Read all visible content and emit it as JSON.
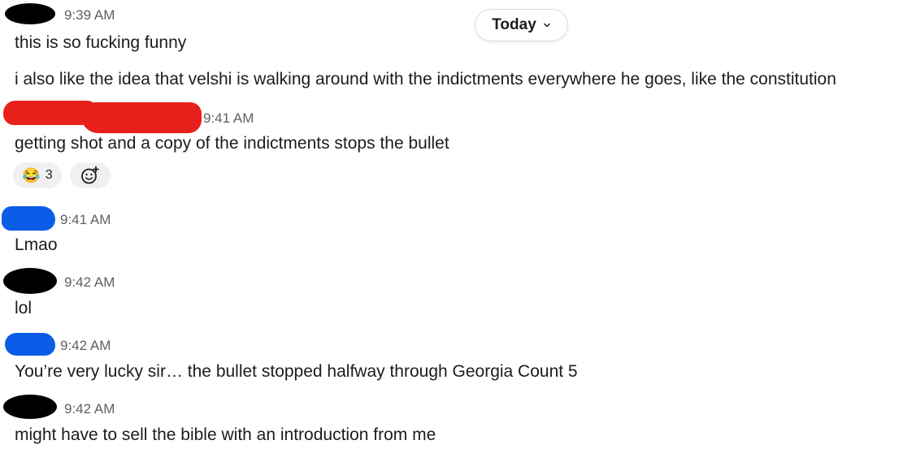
{
  "date_divider": {
    "label": "Today",
    "chevron_icon": "chevron-down-icon"
  },
  "colors": {
    "redaction_black": "#000000",
    "redaction_red": "#e8201c",
    "redaction_blue": "#0b5ce6",
    "timestamp": "#616061",
    "text": "#1d1c1d",
    "reaction_bg": "#f0f0f0"
  },
  "messages": [
    {
      "time": "9:39 AM",
      "lines": [
        "this is so fucking funny",
        "i also like the idea that velshi is walking around with the indictments everywhere he goes, like the constitution"
      ]
    },
    {
      "time": "9:41 AM",
      "lines": [
        "getting shot and a copy of the indictments stops the bullet"
      ],
      "reactions": [
        {
          "emoji": "😂",
          "icon": "joy-emoji-icon",
          "count": "3"
        }
      ],
      "add_reaction_icon": "add-reaction-icon"
    },
    {
      "time": "9:41 AM",
      "lines": [
        "Lmao"
      ]
    },
    {
      "time": "9:42 AM",
      "lines": [
        "lol"
      ]
    },
    {
      "time": "9:42 AM",
      "lines": [
        "You’re very lucky sir… the bullet stopped halfway through Georgia Count 5"
      ]
    },
    {
      "time": "9:42 AM",
      "lines": [
        "might have to sell the bible with an introduction from me"
      ]
    }
  ]
}
